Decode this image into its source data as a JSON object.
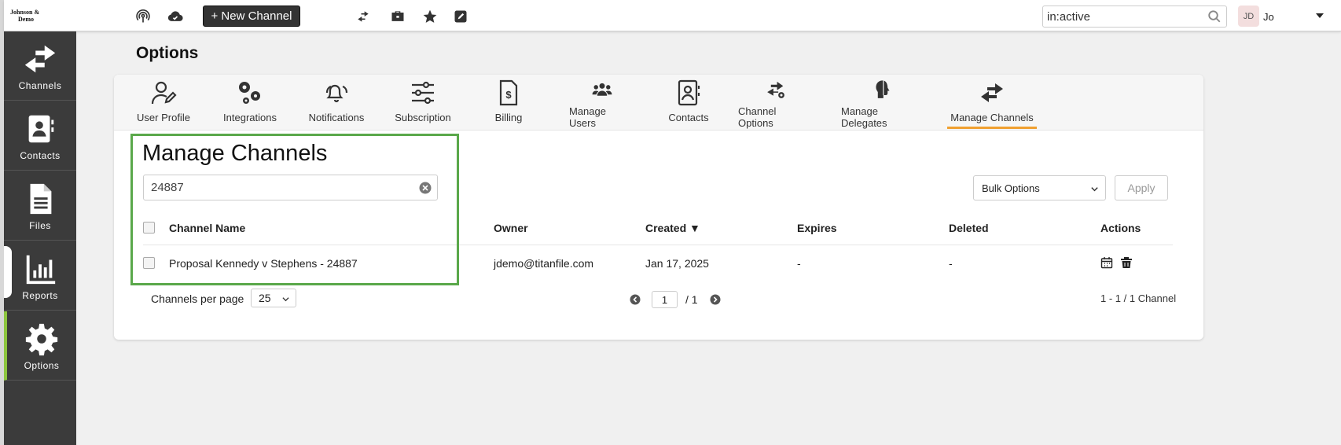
{
  "topbar": {
    "logo_line1": "Johnson &",
    "logo_line2": "Demo",
    "new_channel_label": "+ New Channel",
    "search_value": "in:active",
    "user_initials": "JD",
    "user_name": "Jo",
    "icons": [
      "podcast-icon",
      "cloud-check-icon",
      "arrows-exchange-icon",
      "toolbox-icon",
      "star-icon",
      "edit-icon"
    ]
  },
  "sidebar": {
    "items": [
      {
        "label": "Channels",
        "icon": "arrows-exchange-icon"
      },
      {
        "label": "Contacts",
        "icon": "contact-book-icon"
      },
      {
        "label": "Files",
        "icon": "file-icon"
      },
      {
        "label": "Reports",
        "icon": "bar-chart-icon"
      },
      {
        "label": "Options",
        "icon": "gear-icon"
      }
    ],
    "active": "Options"
  },
  "page": {
    "title": "Options"
  },
  "tabs": [
    {
      "label": "User Profile",
      "icon": "user-edit-icon"
    },
    {
      "label": "Integrations",
      "icon": "gears-icon"
    },
    {
      "label": "Notifications",
      "icon": "bells-icon"
    },
    {
      "label": "Subscription",
      "icon": "sliders-icon"
    },
    {
      "label": "Billing",
      "icon": "invoice-icon"
    },
    {
      "label": "Manage Users",
      "icon": "users-icon"
    },
    {
      "label": "Contacts",
      "icon": "contact-card-icon"
    },
    {
      "label": "Channel Options",
      "icon": "arrows-gear-icon"
    },
    {
      "label": "Manage Delegates",
      "icon": "head-profile-icon"
    },
    {
      "label": "Manage Channels",
      "icon": "arrows-exchange-icon"
    }
  ],
  "active_tab": "Manage Channels",
  "manage": {
    "title": "Manage Channels",
    "filter_value": "24887",
    "bulk_options_label": "Bulk Options",
    "apply_label": "Apply",
    "columns": {
      "name": "Channel Name",
      "owner": "Owner",
      "created": "Created ▼",
      "expires": "Expires",
      "deleted": "Deleted",
      "actions": "Actions"
    },
    "rows": [
      {
        "name": "Proposal Kennedy v Stephens - 24887",
        "owner": "jdemo@titanfile.com",
        "created": "Jan 17, 2025",
        "expires": "-",
        "deleted": "-"
      }
    ],
    "per_page_label": "Channels per page",
    "per_page_value": "25",
    "page_current": "1",
    "page_total": "/ 1",
    "range_text": "1 - 1 / 1 Channel"
  },
  "colors": {
    "sidebar_bg": "#3b3b3b",
    "sidebar_active": "#8dc63f",
    "tab_active_underline": "#f0a030",
    "highlight_border": "#5aa84a"
  }
}
